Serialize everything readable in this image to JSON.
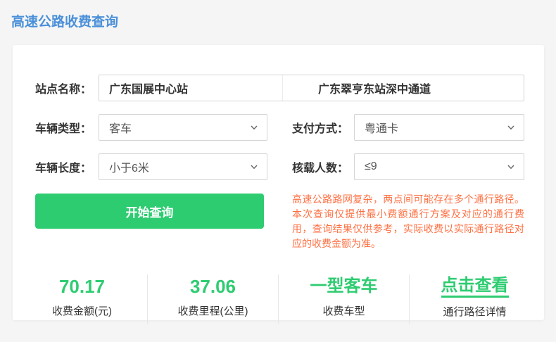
{
  "page": {
    "title": "高速公路收费查询"
  },
  "form": {
    "station": {
      "label": "站点名称：",
      "from": "广东国展中心站",
      "to": "广东翠亨东站深中通道"
    },
    "vehicle_type": {
      "label": "车辆类型：",
      "value": "客车"
    },
    "payment": {
      "label": "支付方式：",
      "value": "粤通卡"
    },
    "vehicle_length": {
      "label": "车辆长度：",
      "value": "小于6米"
    },
    "capacity": {
      "label": "核载人数：",
      "value": "≤9"
    },
    "submit_label": "开始查询",
    "notice": "高速公路路网复杂，两点间可能存在多个通行路径。本次查询仅提供最小费额通行方案及对应的通行费用，查询结果仅供参考，实际收费以实际通行路径对应的收费金额为准。"
  },
  "results": {
    "items": [
      {
        "value": "70.17",
        "label": "收费金额(元)"
      },
      {
        "value": "37.06",
        "label": "收费里程(公里)"
      },
      {
        "value": "一型客车",
        "label": "收费车型"
      },
      {
        "value": "点击查看",
        "label": "通行路径详情"
      }
    ]
  },
  "icons": {
    "chevron_down": "v"
  },
  "colors": {
    "primary_blue": "#4a90d9",
    "success_green": "#2ecc71",
    "notice_orange": "#ff7043",
    "border_gray": "#d4d4d4"
  }
}
